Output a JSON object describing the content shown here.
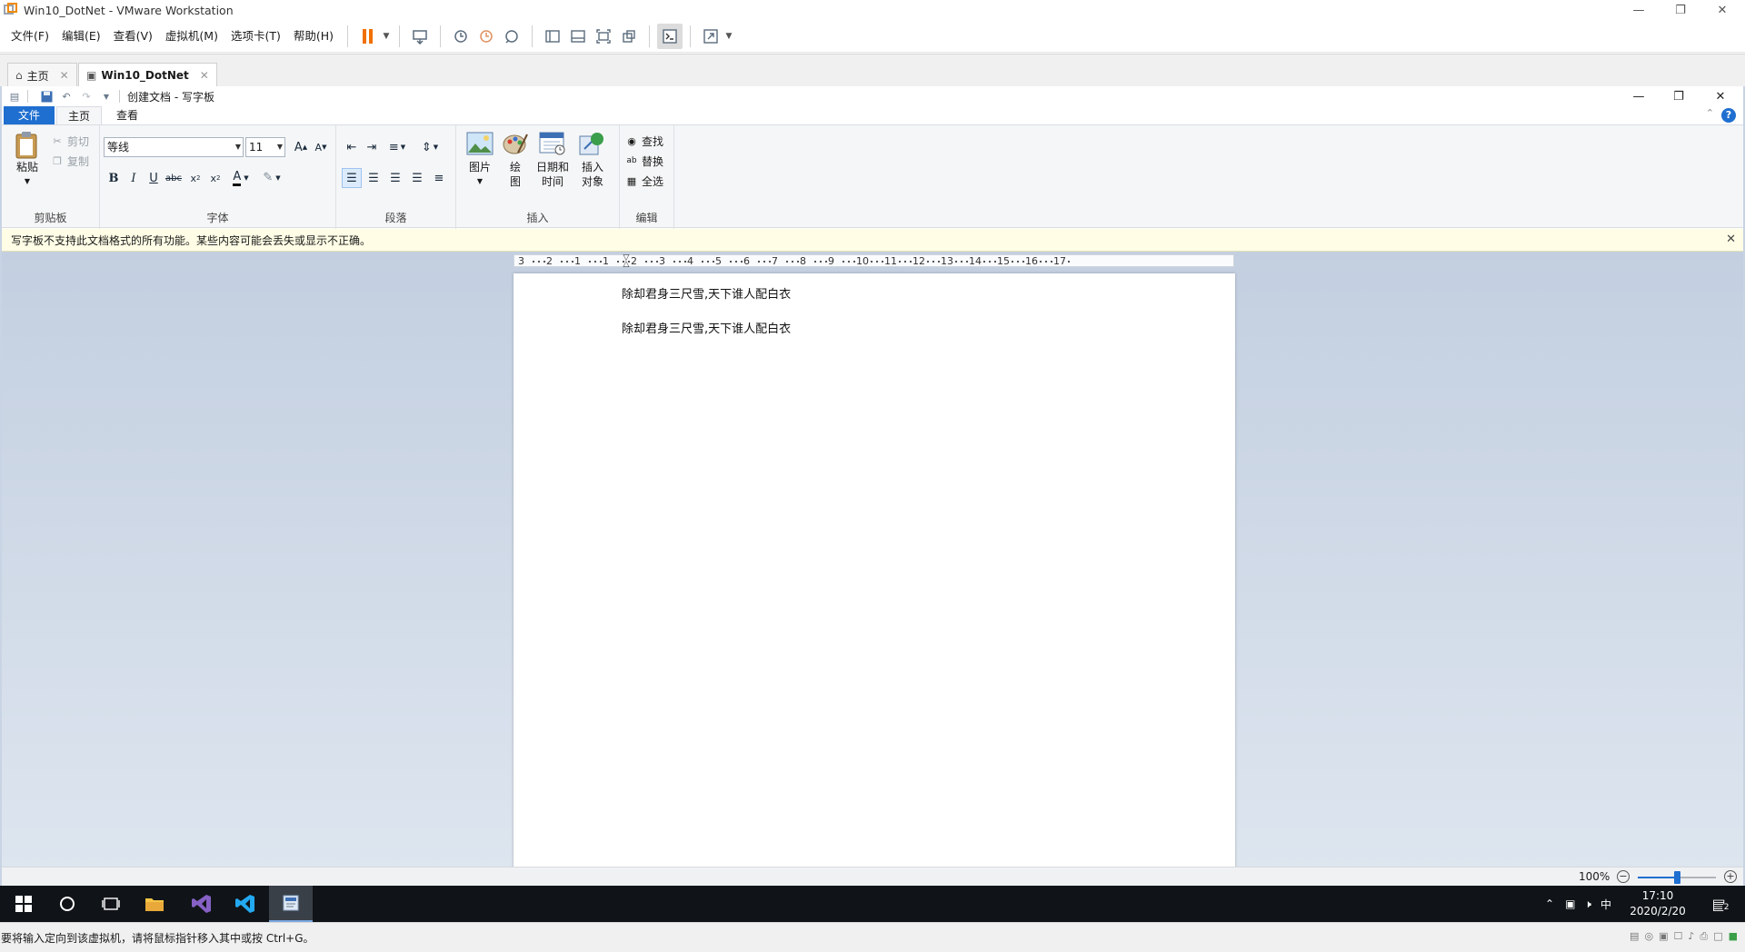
{
  "vmware": {
    "title": "Win10_DotNet - VMware Workstation",
    "menu": [
      "文件(F)",
      "编辑(E)",
      "查看(V)",
      "虚拟机(M)",
      "选项卡(T)",
      "帮助(H)"
    ],
    "tabs": {
      "home_label": "主页",
      "vm_label": "Win10_DotNet"
    },
    "status_text": "要将输入定向到该虚拟机，请将鼠标指针移入其中或按 Ctrl+G。"
  },
  "wordpad": {
    "title": "创建文档 - 写字板",
    "tabs": {
      "file": "文件",
      "home": "主页",
      "view": "查看"
    },
    "clipboard": {
      "paste": "粘贴",
      "cut": "剪切",
      "copy": "复制",
      "group_label": "剪贴板"
    },
    "font": {
      "family": "等线",
      "size": "11",
      "group_label": "字体"
    },
    "paragraph": {
      "group_label": "段落"
    },
    "insert": {
      "picture": "图片",
      "paint": "绘\n图",
      "paint_line1": "绘",
      "paint_line2": "图",
      "datetime_line1": "日期和",
      "datetime_line2": "时间",
      "object_line1": "插入",
      "object_line2": "对象",
      "group_label": "插入"
    },
    "editing": {
      "find": "查找",
      "replace": "替换",
      "select_all": "全选",
      "group_label": "编辑"
    },
    "info_bar": "写字板不支持此文档格式的所有功能。某些内容可能会丢失或显示不正确。",
    "document_lines": [
      "除却君身三尺雪,天下谁人配白衣",
      "除却君身三尺雪,天下谁人配白衣"
    ],
    "ruler_labels": [
      "3",
      "2",
      "1",
      "1",
      "2",
      "3",
      "4",
      "5",
      "6",
      "7",
      "8",
      "9",
      "10",
      "11",
      "12",
      "13",
      "14",
      "15",
      "16",
      "17"
    ],
    "zoom": {
      "label": "100%",
      "level_fraction": 0.5
    }
  },
  "taskbar": {
    "time": "17:10",
    "date": "2020/2/20",
    "ime": "中",
    "notification_count": "2"
  },
  "colors": {
    "accent": "#1f6fd0",
    "pause": "#f07000",
    "taskbar": "#101418",
    "info_bar": "#fffde6"
  }
}
